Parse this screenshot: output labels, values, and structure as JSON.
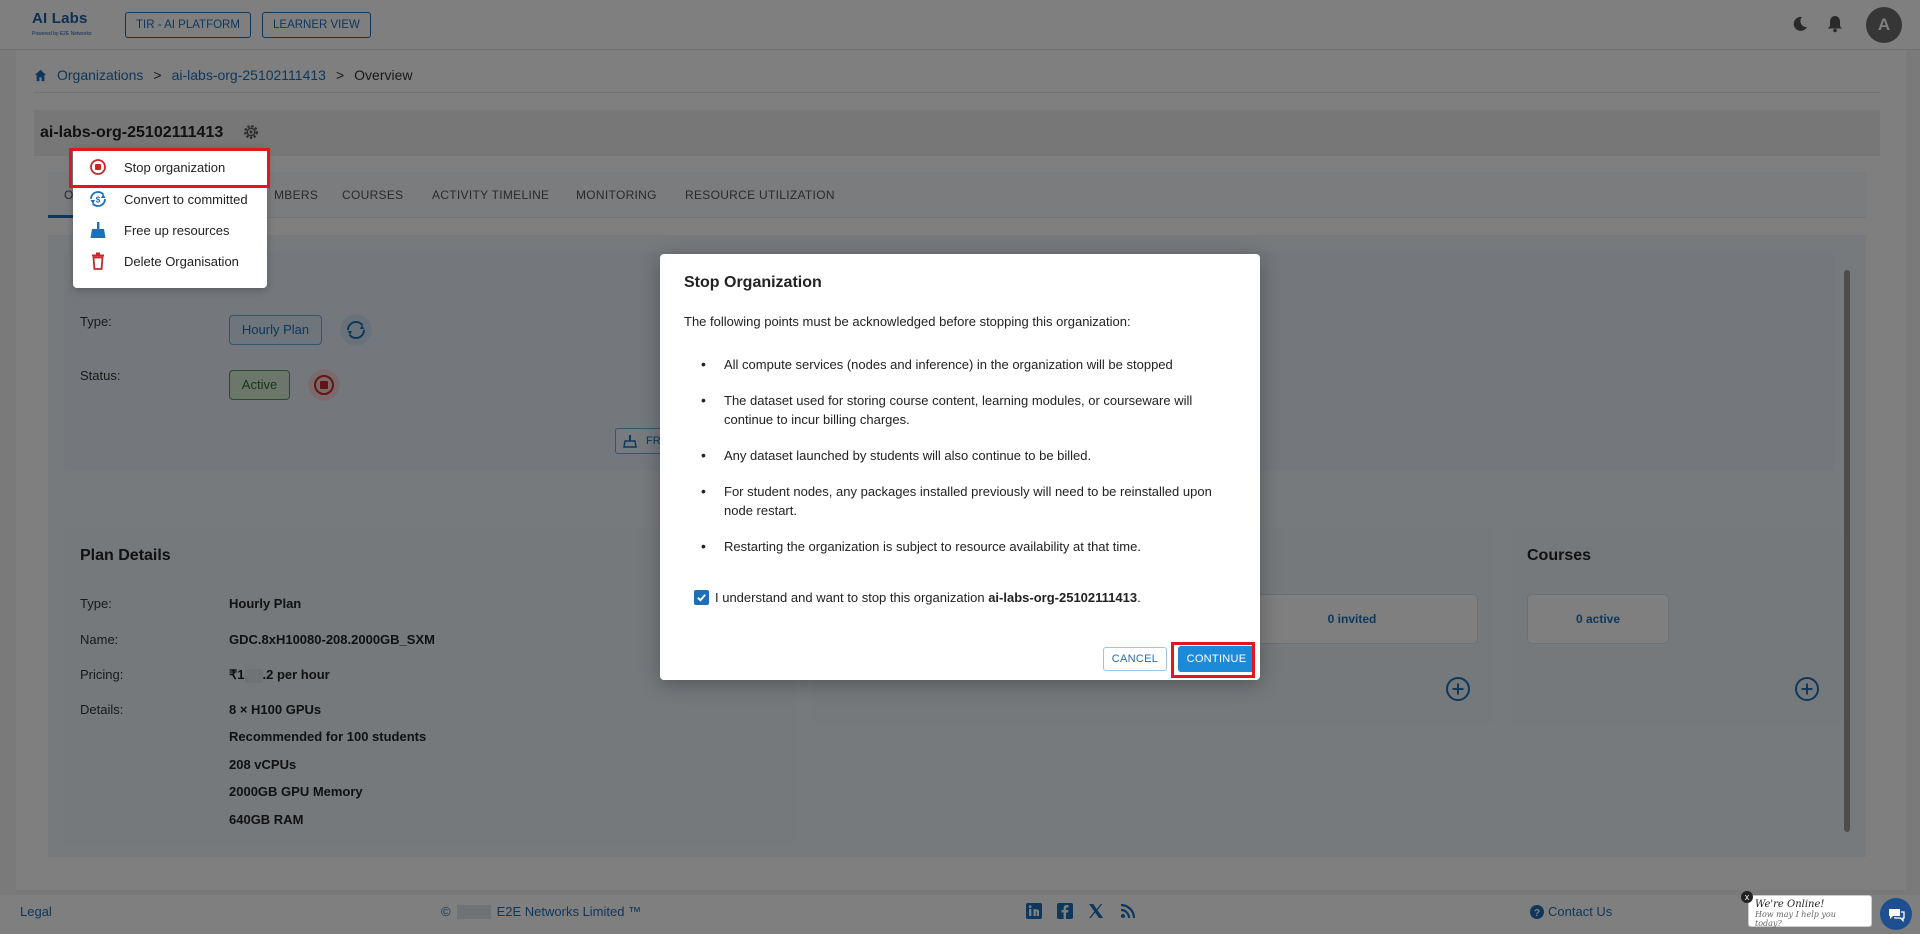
{
  "header": {
    "logo_main": "AI Labs",
    "logo_sub": "Powered by E2E Networks",
    "btn_platform": "TIR - AI PLATFORM",
    "btn_learner": "LEARNER VIEW",
    "avatar_initial": "A"
  },
  "breadcrumb": {
    "items": [
      "Organizations",
      "ai-labs-org-25102111413",
      "Overview"
    ],
    "separator": ">"
  },
  "org": {
    "title": "ai-labs-org-25102111413"
  },
  "tabs": [
    "OVERVIEW",
    "MEMBERS",
    "COURSES",
    "ACTIVITY TIMELINE",
    "MONITORING",
    "RESOURCE UTILIZATION"
  ],
  "tabs_visible": [
    "O",
    "MBERS",
    "COURSES",
    "ACTIVITY TIMELINE",
    "MONITORING",
    "RESOURCE UTILIZATION"
  ],
  "overview": {
    "type_label": "Type:",
    "type_value": "Hourly Plan",
    "status_label": "Status:",
    "status_value": "Active",
    "free_btn_partial": "FR"
  },
  "plan_details": {
    "title": "Plan Details",
    "rows": [
      {
        "label": "Type:",
        "value": "Hourly Plan"
      },
      {
        "label": "Name:",
        "value": "GDC.8xH10080-208.2000GB_SXM"
      },
      {
        "label": "Pricing:",
        "value_prefix": "₹1",
        "value_suffix": ".2 per hour"
      },
      {
        "label": "Details:",
        "value": "8 × H100 GPUs"
      }
    ],
    "details_extra": [
      "Recommended for 100 students",
      "208 vCPUs",
      "2000GB GPU Memory",
      "640GB RAM"
    ]
  },
  "members": {
    "invited": "0 invited"
  },
  "courses": {
    "title": "Courses",
    "active": "0 active"
  },
  "menu": {
    "items": [
      "Stop organization",
      "Convert to committed",
      "Free up resources",
      "Delete Organisation"
    ]
  },
  "modal": {
    "title": "Stop Organization",
    "intro": "The following points must be acknowledged before stopping this organization:",
    "points": [
      "All compute services (nodes and inference) in the organization will be stopped",
      "The dataset used for storing course content, learning modules, or courseware will continue to incur billing charges.",
      "Any dataset launched by students will also continue to be billed.",
      "For student nodes, any packages installed previously will need to be reinstalled upon node restart.",
      "Restarting the organization is subject to resource availability at that time."
    ],
    "ack_text": "I understand and want to stop this organization",
    "ack_org": "ai-labs-org-25102111413",
    "ack_end": ".",
    "cancel_label": "CANCEL",
    "continue_label": "CONTINUE"
  },
  "footer": {
    "legal": "Legal",
    "copyright_symbol": "©",
    "copyright": "E2E Networks Limited ™",
    "contact": "Contact Us",
    "chat_title": "We're Online!",
    "chat_sub": "How may I help you today?",
    "chat_close": "x"
  },
  "colors": {
    "accent": "#1d6fb8",
    "highlight": "#e0181e",
    "continue_bg": "#1d8ad8"
  }
}
